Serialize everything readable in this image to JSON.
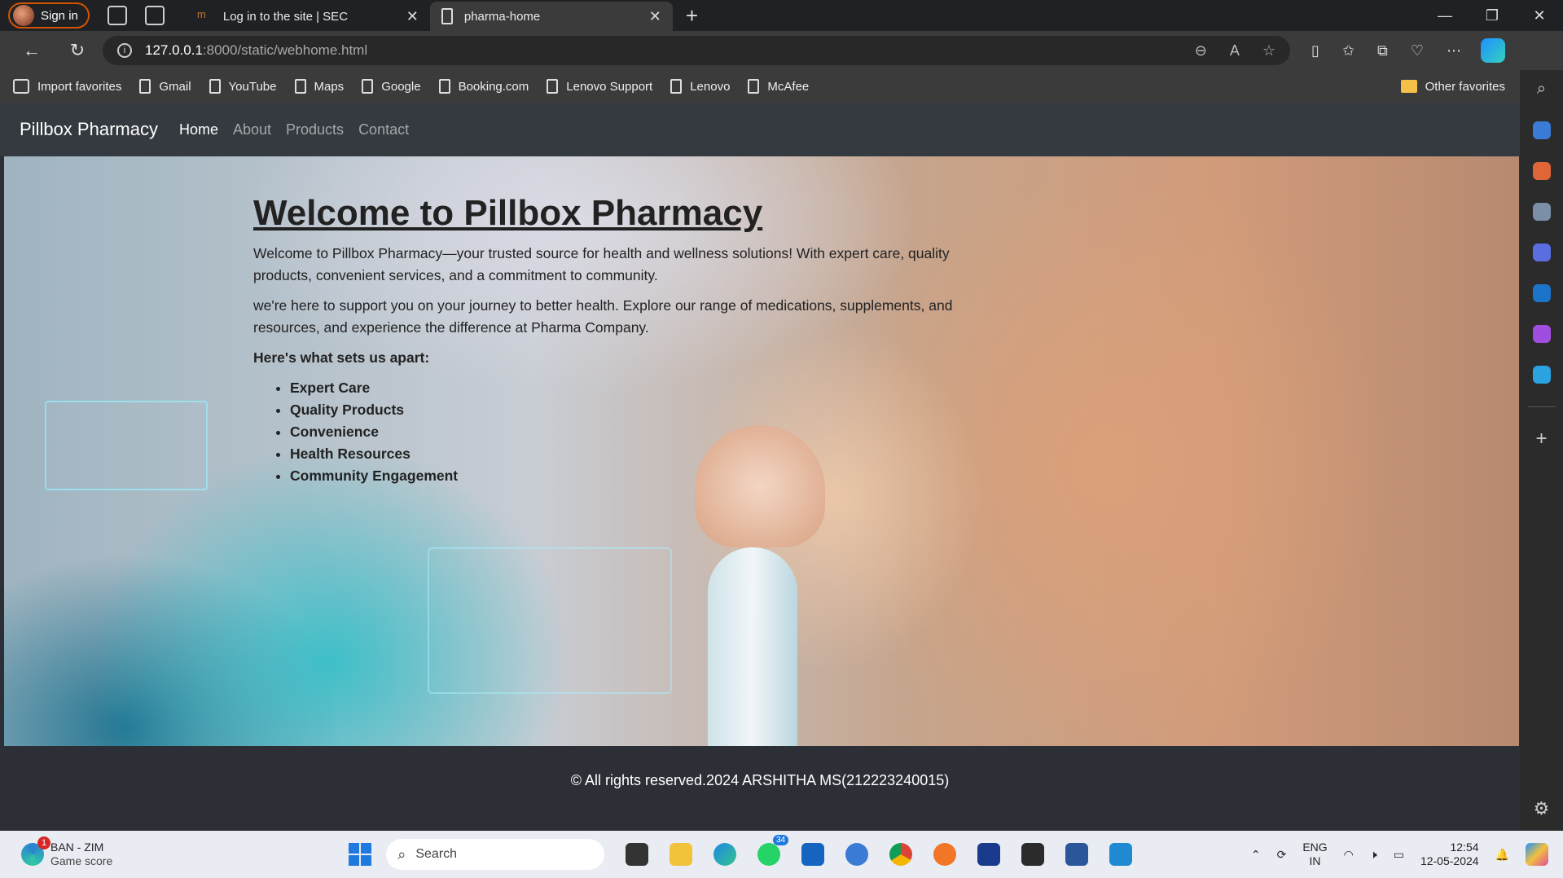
{
  "browser": {
    "signin_label": "Sign in",
    "tabs": [
      {
        "label": "Log in to the site | SEC",
        "active": false
      },
      {
        "label": "pharma-home",
        "active": true
      }
    ],
    "url_host": "127.0.0.1",
    "url_path": ":8000/static/webhome.html",
    "favorites": [
      "Import favorites",
      "Gmail",
      "YouTube",
      "Maps",
      "Google",
      "Booking.com",
      "Lenovo Support",
      "Lenovo",
      "McAfee"
    ],
    "other_favorites": "Other favorites"
  },
  "site": {
    "brand": "Pillbox Pharmacy",
    "nav": [
      {
        "label": "Home",
        "active": true
      },
      {
        "label": "About",
        "active": false
      },
      {
        "label": "Products",
        "active": false
      },
      {
        "label": "Contact",
        "active": false
      }
    ],
    "heading": "Welcome to Pillbox Pharmacy",
    "para1": "Welcome to Pillbox Pharmacy—your trusted source for health and wellness solutions! With expert care, quality products, convenient services, and a commitment to community.",
    "para2": "we're here to support you on your journey to better health. Explore our range of medications, supplements, and resources, and experience the difference at Pharma Company.",
    "apart_heading": "Here's what sets us apart:",
    "features": [
      "Expert Care",
      "Quality Products",
      "Convenience",
      "Health Resources",
      "Community Engagement"
    ],
    "footer": "© All rights reserved.2024 ARSHITHA MS(212223240015)"
  },
  "taskbar": {
    "score_title": "BAN - ZIM",
    "score_sub": "Game score",
    "score_badge": "1",
    "search_placeholder": "Search",
    "whatsapp_badge": "34",
    "lang_top": "ENG",
    "lang_bottom": "IN",
    "time": "12:54",
    "date": "12-05-2024"
  },
  "colors": {
    "navbar": "#343a40",
    "accent_tab": "#3b3b3b",
    "signin_border": "#d35400"
  }
}
